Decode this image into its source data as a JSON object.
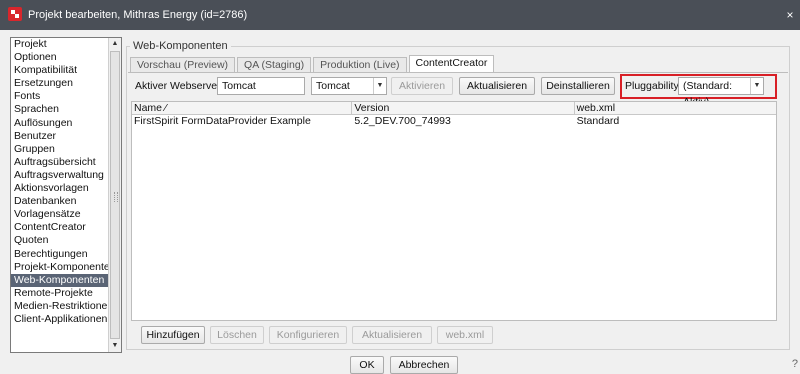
{
  "window": {
    "title": "Projekt bearbeiten, Mithras Energy (id=2786)",
    "close": "×"
  },
  "sidebar": {
    "items": [
      {
        "label": "Projekt"
      },
      {
        "label": "Optionen"
      },
      {
        "label": "Kompatibilität"
      },
      {
        "label": "Ersetzungen"
      },
      {
        "label": "Fonts"
      },
      {
        "label": "Sprachen"
      },
      {
        "label": "Auflösungen"
      },
      {
        "label": "Benutzer"
      },
      {
        "label": "Gruppen"
      },
      {
        "label": "Auftragsübersicht"
      },
      {
        "label": "Auftragsverwaltung"
      },
      {
        "label": "Aktionsvorlagen"
      },
      {
        "label": "Datenbanken"
      },
      {
        "label": "Vorlagensätze"
      },
      {
        "label": "ContentCreator"
      },
      {
        "label": "Quoten"
      },
      {
        "label": "Berechtigungen"
      },
      {
        "label": "Projekt-Komponenten"
      },
      {
        "label": "Web-Komponenten"
      },
      {
        "label": "Remote-Projekte"
      },
      {
        "label": "Medien-Restriktionen"
      },
      {
        "label": "Client-Applikationen"
      }
    ],
    "selected": "Web-Komponenten"
  },
  "group": {
    "legend": "Web-Komponenten"
  },
  "tabs": [
    {
      "label": "Vorschau (Preview)"
    },
    {
      "label": "QA (Staging)"
    },
    {
      "label": "Produktion (Live)"
    },
    {
      "label": "ContentCreator"
    }
  ],
  "toolbar": {
    "webserver_label": "Aktiver Webserver:",
    "webserver_value": "Tomcat",
    "webserver_select": "Tomcat",
    "activate": "Aktivieren",
    "update": "Aktualisieren",
    "uninstall": "Deinstallieren",
    "pluggability_label": "Pluggability:",
    "pluggability_value": "(Standard: Aktiv)"
  },
  "table": {
    "headers": [
      "Name ⁄",
      "Version",
      "web.xml"
    ],
    "rows": [
      [
        "FirstSpirit FormDataProvider Example",
        "5.2_DEV.700_74993",
        "Standard"
      ]
    ]
  },
  "actions": {
    "add": "Hinzufügen",
    "delete": "Löschen",
    "configure": "Konfigurieren",
    "update": "Aktualisieren",
    "webxml": "web.xml"
  },
  "dialog": {
    "ok": "OK",
    "cancel": "Abbrechen",
    "help": "?"
  },
  "colors": {
    "titlebar": "#4a4f57",
    "selected": "#5a6475",
    "highlight": "#d81f26",
    "app_icon": "#d9262c"
  }
}
